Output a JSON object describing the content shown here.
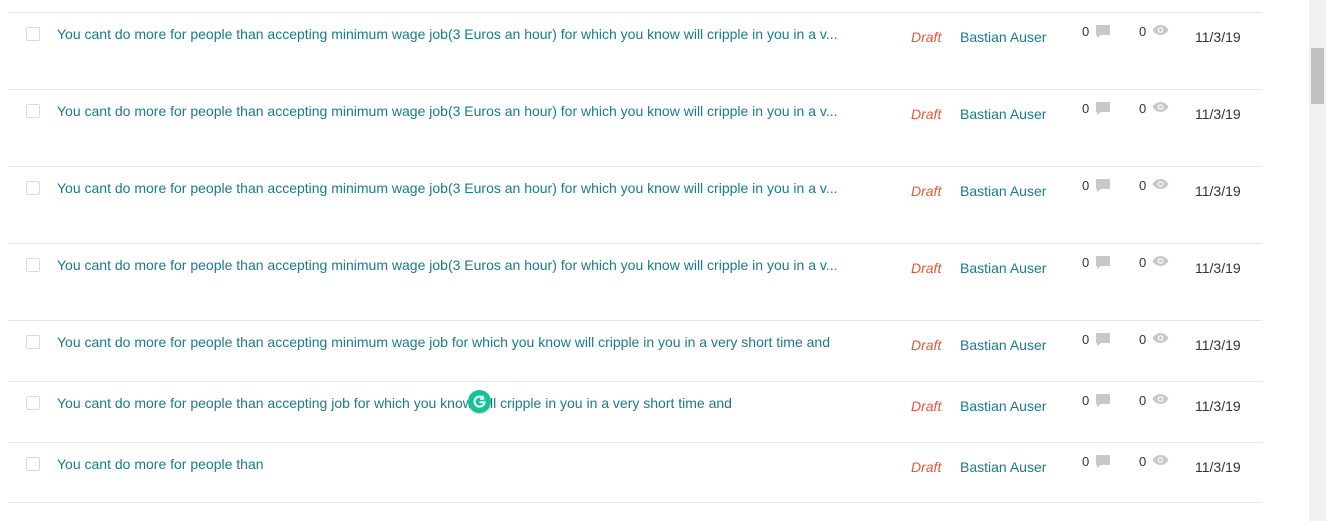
{
  "posts": [
    {
      "title": "You cant do more for people than accepting minimum wage job(3 Euros an hour) for which you know will cripple in you in a v...",
      "status": "Draft",
      "author": "Bastian Auser",
      "comments": "0",
      "views": "0",
      "date": "11/3/19"
    },
    {
      "title": "You cant do more for people than accepting minimum wage job(3 Euros an hour) for which you know will cripple in you in a v...",
      "status": "Draft",
      "author": "Bastian Auser",
      "comments": "0",
      "views": "0",
      "date": "11/3/19"
    },
    {
      "title": "You cant do more for people than accepting minimum wage job(3 Euros an hour) for which you know will cripple in you in a v...",
      "status": "Draft",
      "author": "Bastian Auser",
      "comments": "0",
      "views": "0",
      "date": "11/3/19"
    },
    {
      "title": "You cant do more for people than accepting minimum wage job(3 Euros an hour) for which you know will cripple in you in a v...",
      "status": "Draft",
      "author": "Bastian Auser",
      "comments": "0",
      "views": "0",
      "date": "11/3/19"
    },
    {
      "title": "You cant do more for people than accepting minimum wage job for which you know will cripple in you in a very short time and",
      "status": "Draft",
      "author": "Bastian Auser",
      "comments": "0",
      "views": "0",
      "date": "11/3/19"
    },
    {
      "title": "You cant do more for people than accepting job for which you know will cripple in you in a very short time and",
      "status": "Draft",
      "author": "Bastian Auser",
      "comments": "0",
      "views": "0",
      "date": "11/3/19"
    },
    {
      "title": "You cant do more for people than",
      "status": "Draft",
      "author": "Bastian Auser",
      "comments": "0",
      "views": "0",
      "date": "11/3/19"
    }
  ],
  "icons": {
    "comment": "comment-icon",
    "views": "eye-icon",
    "grammarly": "grammarly-icon"
  },
  "colors": {
    "link": "#1a7a8c",
    "draft": "#e8563a",
    "grammarly": "#15c39a",
    "icon": "#c8c8c8"
  }
}
